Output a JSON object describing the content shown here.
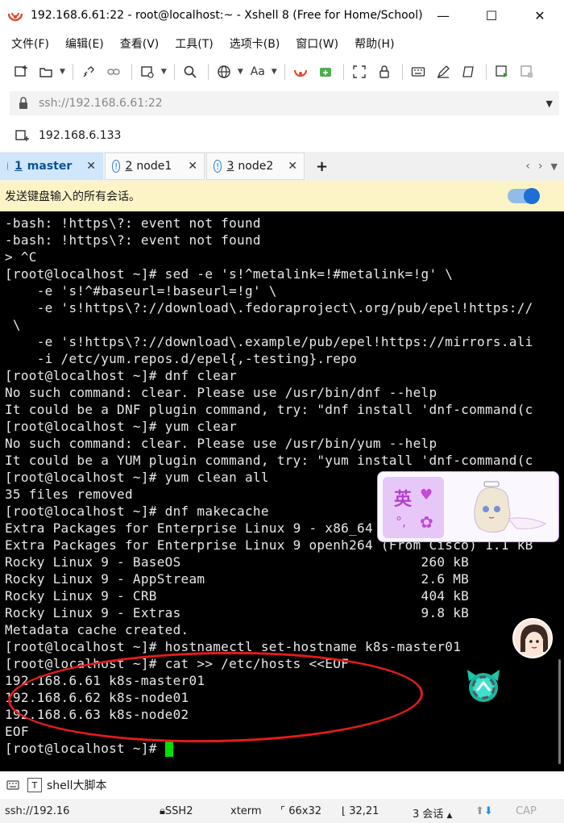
{
  "window": {
    "title": "192.168.6.61:22 - root@localhost:~ - Xshell 8 (Free for Home/School)"
  },
  "menu": [
    "文件(F)",
    "编辑(E)",
    "查看(V)",
    "工具(T)",
    "选项卡(B)",
    "窗口(W)",
    "帮助(H)"
  ],
  "address": {
    "placeholder": "ssh://192.168.6.61:22"
  },
  "host": {
    "label": "192.168.6.133"
  },
  "tabs": [
    {
      "num": "1",
      "name": "master",
      "status": "connected"
    },
    {
      "num": "2",
      "name": "node1",
      "status": "warning"
    },
    {
      "num": "3",
      "name": "node2",
      "status": "warning"
    }
  ],
  "notice": {
    "text": "发送键盘输入的所有会话。",
    "toggle_on": true
  },
  "terminal": {
    "lines": [
      "-bash: !https\\?: event not found",
      "-bash: !https\\?: event not found",
      "> ^C",
      "[root@localhost ~]# sed -e 's!^metalink=!#metalink=!g' \\",
      "    -e 's!^#baseurl=!baseurl=!g' \\",
      "    -e 's!https\\?://download\\.fedoraproject\\.org/pub/epel!https://",
      " \\",
      "    -e 's!https\\?://download\\.example/pub/epel!https://mirrors.ali",
      "    -i /etc/yum.repos.d/epel{,-testing}.repo",
      "[root@localhost ~]# dnf clear",
      "No such command: clear. Please use /usr/bin/dnf --help",
      "It could be a DNF plugin command, try: \"dnf install 'dnf-command(c",
      "[root@localhost ~]# yum clear",
      "No such command: clear. Please use /usr/bin/yum --help",
      "It could be a YUM plugin command, try: \"yum install 'dnf-command(c",
      "[root@localhost ~]# yum clean all",
      "35 files removed",
      "[root@localhost ~]# dnf makecache",
      "Extra Packages for Enterprise Linux 9 - x86_64",
      "Extra Packages for Enterprise Linux 9 openh264 (From Cisco) 1.1 kB",
      "Rocky Linux 9 - BaseOS                              260 kB",
      "Rocky Linux 9 - AppStream                           2.6 MB",
      "Rocky Linux 9 - CRB                                 404 kB",
      "Rocky Linux 9 - Extras                              9.8 kB",
      "Metadata cache created.",
      "[root@localhost ~]# hostnamectl set-hostname k8s-master01",
      "[root@localhost ~]# cat >> /etc/hosts <<EOF",
      "192.168.6.61 k8s-master01",
      "192.168.6.62 k8s-node01",
      "192.168.6.63 k8s-node02",
      "EOF",
      "[root@localhost ~]# "
    ]
  },
  "widget": {
    "char": "英"
  },
  "bottom": {
    "label": "shell大脚本"
  },
  "status": {
    "conn": "ssh://192.16",
    "protocol": "SSH2",
    "term": "xterm",
    "size": "66x32",
    "pos": "32,21",
    "sessions": "3 会话",
    "cap": "CAP"
  }
}
